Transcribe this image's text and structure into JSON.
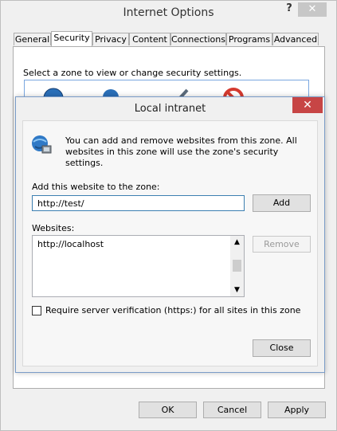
{
  "parent_window": {
    "title": "Internet Options",
    "help_glyph": "?",
    "close_glyph": "✕",
    "tabs": [
      {
        "label": "General"
      },
      {
        "label": "Security",
        "active": true
      },
      {
        "label": "Privacy"
      },
      {
        "label": "Content"
      },
      {
        "label": "Connections"
      },
      {
        "label": "Programs"
      },
      {
        "label": "Advanced"
      }
    ],
    "zone_prompt": "Select a zone to view or change security settings.",
    "buttons": {
      "ok": "OK",
      "cancel": "Cancel",
      "apply": "Apply"
    }
  },
  "dialog": {
    "title": "Local intranet",
    "close_glyph": "✕",
    "info_text": "You can add and remove websites from this zone. All websites in this zone will use the zone's security settings.",
    "add_label": "Add this website to the zone:",
    "site_input_value": "http://test/",
    "add_button": "Add",
    "websites_label": "Websites:",
    "websites": [
      "http://localhost"
    ],
    "remove_button": "Remove",
    "verify_label": "Require server verification (https:) for all sites in this zone",
    "verify_checked": false,
    "close_button": "Close"
  },
  "colors": {
    "dialog_close_bg": "#c74545",
    "focus_border": "#3c7fb1"
  }
}
